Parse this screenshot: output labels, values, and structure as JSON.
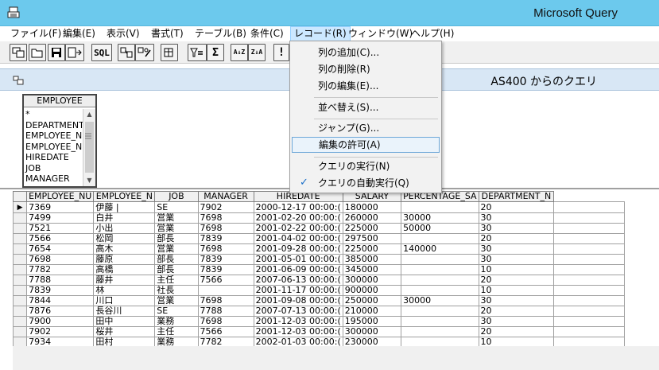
{
  "window": {
    "title": "Microsoft Query"
  },
  "menubar": {
    "items": [
      {
        "label": "ファイル(F)"
      },
      {
        "label": "編集(E)"
      },
      {
        "label": "表示(V)"
      },
      {
        "label": "書式(T)"
      },
      {
        "label": "テーブル(B)"
      },
      {
        "label": "条件(C)"
      },
      {
        "label": "レコード(R)"
      },
      {
        "label": "ウィンドウ(W)"
      },
      {
        "label": "ヘルプ(H)"
      }
    ]
  },
  "toolbar": {
    "sql_label": "SQL",
    "sort_asc_label": "A↓Z",
    "sort_desc_label": "Z↓A",
    "sum_label": "Σ",
    "run_label": "!"
  },
  "query": {
    "title": "AS400 からのクエリ"
  },
  "table_box": {
    "name": "EMPLOYEE",
    "fields": [
      "*",
      "DEPARTMENT_",
      "EMPLOYEE_N",
      "EMPLOYEE_N",
      "HIREDATE",
      "JOB",
      "MANAGER"
    ]
  },
  "record_menu": {
    "items": [
      {
        "label": "列の追加(C)..."
      },
      {
        "label": "列の削除(R)"
      },
      {
        "label": "列の編集(E)..."
      },
      {
        "label": "並べ替え(S)..."
      },
      {
        "label": "ジャンプ(G)..."
      },
      {
        "label": "編集の許可(A)"
      },
      {
        "label": "クエリの実行(N)"
      },
      {
        "label": "クエリの自動実行(Q)"
      }
    ],
    "checkmark": "✓"
  },
  "grid": {
    "columns": [
      "EMPLOYEE_NU",
      "EMPLOYEE_N",
      "JOB",
      "MANAGER",
      "HIREDATE",
      "SALARY",
      "PERCENTAGE_SA",
      "DEPARTMENT_N"
    ],
    "current_row_marker": "▶",
    "rows": [
      [
        "7369",
        "伊藤 |",
        "SE",
        "7902",
        "2000-12-17 00:00:(",
        "180000",
        "",
        "20"
      ],
      [
        "7499",
        "白井",
        "営業",
        "7698",
        "2001-02-20 00:00:(",
        "260000",
        "30000",
        "30"
      ],
      [
        "7521",
        "小出",
        "営業",
        "7698",
        "2001-02-22 00:00:(",
        "225000",
        "50000",
        "30"
      ],
      [
        "7566",
        "松岡",
        "部長",
        "7839",
        "2001-04-02 00:00:(",
        "297500",
        "",
        "20"
      ],
      [
        "7654",
        "高木",
        "営業",
        "7698",
        "2001-09-28 00:00:(",
        "225000",
        "140000",
        "30"
      ],
      [
        "7698",
        "藤原",
        "部長",
        "7839",
        "2001-05-01 00:00:(",
        "385000",
        "",
        "30"
      ],
      [
        "7782",
        "高橋",
        "部長",
        "7839",
        "2001-06-09 00:00:(",
        "345000",
        "",
        "10"
      ],
      [
        "7788",
        "藤井",
        "主任",
        "7566",
        "2007-06-13 00:00:(",
        "300000",
        "",
        "20"
      ],
      [
        "7839",
        "林",
        "社長",
        "",
        "2001-11-17 00:00:(",
        "900000",
        "",
        "10"
      ],
      [
        "7844",
        "川口",
        "営業",
        "7698",
        "2001-09-08 00:00:(",
        "250000",
        "30000",
        "30"
      ],
      [
        "7876",
        "長谷川",
        "SE",
        "7788",
        "2007-07-13 00:00:(",
        "210000",
        "",
        "20"
      ],
      [
        "7900",
        "田中",
        "業務",
        "7698",
        "2001-12-03 00:00:(",
        "195000",
        "",
        "30"
      ],
      [
        "7902",
        "桜井",
        "主任",
        "7566",
        "2001-12-03 00:00:(",
        "300000",
        "",
        "20"
      ],
      [
        "7934",
        "田村",
        "業務",
        "7782",
        "2002-01-03 00:00:(",
        "230000",
        "",
        "10"
      ]
    ]
  }
}
